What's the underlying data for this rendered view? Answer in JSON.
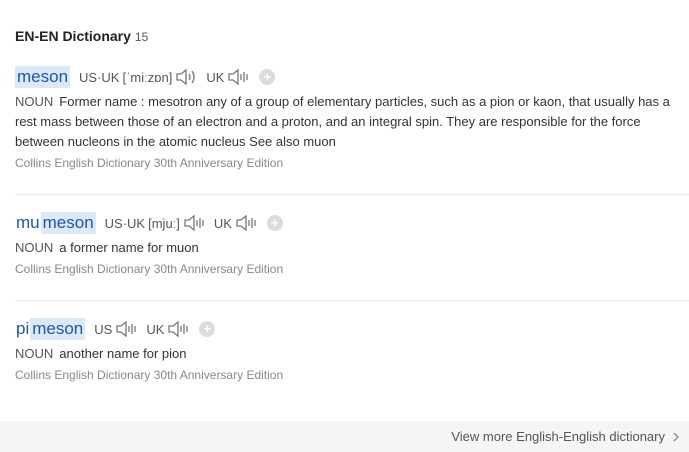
{
  "header": {
    "title": "EN-EN Dictionary",
    "count": "15"
  },
  "entries": [
    {
      "word_parts": [
        {
          "text": "meson",
          "highlighted": true
        }
      ],
      "pron": [
        {
          "label": "US·UK",
          "phonetic": "[ˈmiːzɒn]"
        },
        {
          "label": "UK",
          "phonetic": ""
        }
      ],
      "pos": "NOUN",
      "definition": "Former name : mesotron any of a group of elementary particles, such as a pion or kaon, that usually has a rest mass between those of an electron and a proton, and an integral spin. They are responsible for the force between nucleons in the atomic nucleus See also muon",
      "source": "Collins English Dictionary 30th Anniversary Edition"
    },
    {
      "word_parts": [
        {
          "text": "mu",
          "highlighted": false
        },
        {
          "text": "meson",
          "highlighted": true
        }
      ],
      "pron": [
        {
          "label": "US·UK",
          "phonetic": "[mjuː]"
        },
        {
          "label": "UK",
          "phonetic": ""
        }
      ],
      "pos": "NOUN",
      "definition": "a former name for muon",
      "source": "Collins English Dictionary 30th Anniversary Edition"
    },
    {
      "word_parts": [
        {
          "text": "pi",
          "highlighted": false
        },
        {
          "text": "meson",
          "highlighted": true
        }
      ],
      "pron": [
        {
          "label": "US",
          "phonetic": ""
        },
        {
          "label": "UK",
          "phonetic": ""
        }
      ],
      "pos": "NOUN",
      "definition": "another name for pion",
      "source": "Collins English Dictionary 30th Anniversary Edition"
    }
  ],
  "footer": {
    "link_label": "View more English-English dictionary",
    "icon": "chevron-right-icon"
  },
  "icons": {
    "speaker": "speaker-icon",
    "add": "add-icon"
  },
  "colors": {
    "word": "#1a55b5",
    "highlight": "#dceaf8",
    "source": "#888888",
    "footer_bg": "#f5f5f5"
  }
}
